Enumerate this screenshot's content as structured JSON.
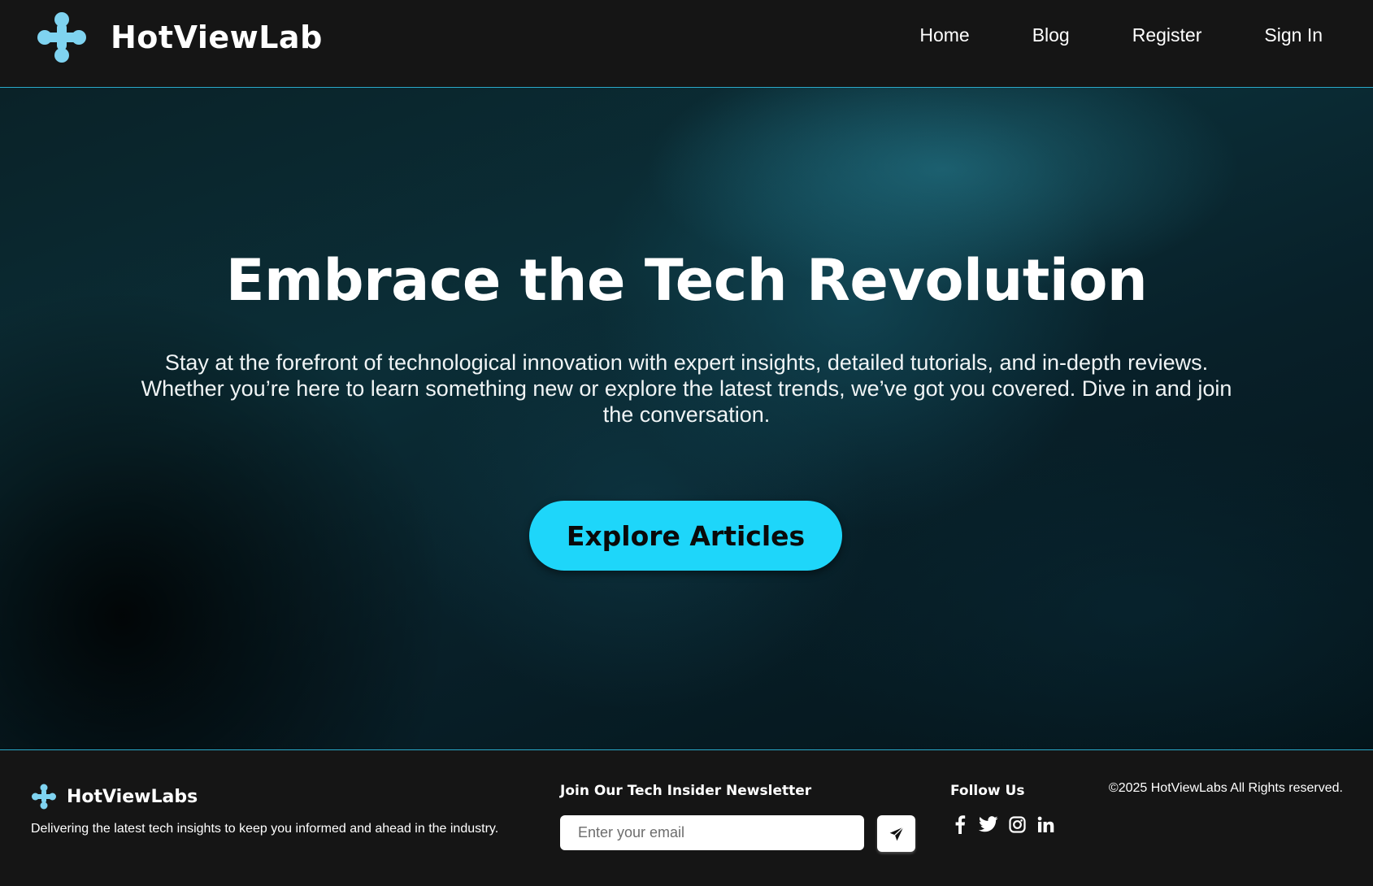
{
  "header": {
    "brand_name": "HotViewLab",
    "logo_icon": "molecule-logo-icon",
    "nav": [
      {
        "label": "Home"
      },
      {
        "label": "Blog"
      },
      {
        "label": "Register"
      },
      {
        "label": "Sign In"
      }
    ]
  },
  "hero": {
    "title": "Embrace the Tech Revolution",
    "text": "Stay at the forefront of technological innovation with expert insights, detailed tutorials, and in-depth reviews. Whether you’re here to learn something new or explore the latest trends, we’ve got you covered. Dive in and join the conversation.",
    "cta_label": "Explore Articles"
  },
  "footer": {
    "brand_name": "HotViewLabs",
    "tagline": "Delivering the latest tech insights to keep you informed and ahead in the industry.",
    "newsletter_title": "Join Our Tech Insider Newsletter",
    "email_placeholder": "Enter your email",
    "send_icon": "paper-plane-icon",
    "follow_title": "Follow Us",
    "socials": [
      {
        "icon": "facebook-icon"
      },
      {
        "icon": "twitter-icon"
      },
      {
        "icon": "instagram-icon"
      },
      {
        "icon": "linkedin-icon"
      }
    ],
    "copyright": "©2025 HotViewLabs All Rights reserved."
  },
  "colors": {
    "accent": "#1ed6fa",
    "logo": "#7fd3f0",
    "background": "#151515",
    "divider": "#2aa9c9"
  }
}
